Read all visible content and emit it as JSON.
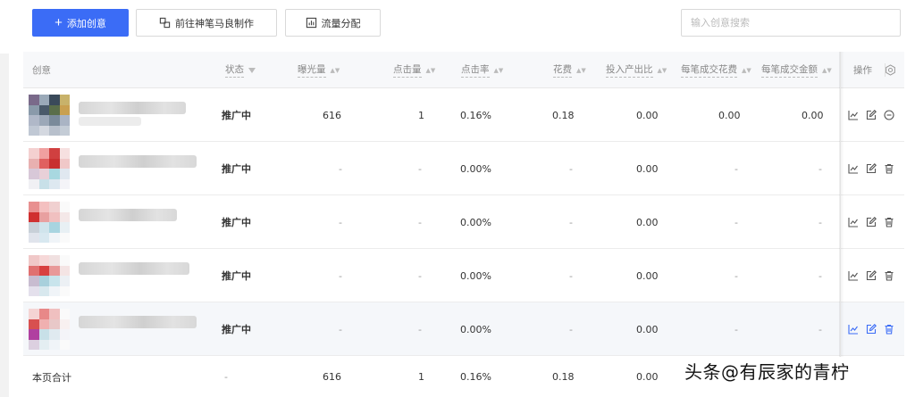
{
  "toolbar": {
    "add_label": "添加创意",
    "tool_label": "前往神笔马良制作",
    "flow_label": "流量分配",
    "search_placeholder": "输入创意搜索"
  },
  "columns": {
    "creative": "创意",
    "status": "状态",
    "impressions": "曝光量",
    "clicks": "点击量",
    "ctr": "点击率",
    "cost": "花费",
    "roi": "投入产出比",
    "cost_per_deal": "每笔成交花费",
    "amount_per_deal": "每笔成交金额",
    "actions": "操作"
  },
  "rows": [
    {
      "status": "推广中",
      "impressions": "616",
      "clicks": "1",
      "ctr": "0.16%",
      "cost": "0.18",
      "roi": "0.00",
      "cost_per_deal": "0.00",
      "amount_per_deal": "0.00",
      "third_icon": "minus-circle-icon"
    },
    {
      "status": "推广中",
      "impressions": "-",
      "clicks": "-",
      "ctr": "0.00%",
      "cost": "-",
      "roi": "0.00",
      "cost_per_deal": "-",
      "amount_per_deal": "-",
      "third_icon": "trash-icon"
    },
    {
      "status": "推广中",
      "impressions": "-",
      "clicks": "-",
      "ctr": "0.00%",
      "cost": "-",
      "roi": "0.00",
      "cost_per_deal": "-",
      "amount_per_deal": "-",
      "third_icon": "trash-icon"
    },
    {
      "status": "推广中",
      "impressions": "-",
      "clicks": "-",
      "ctr": "0.00%",
      "cost": "-",
      "roi": "0.00",
      "cost_per_deal": "-",
      "amount_per_deal": "-",
      "third_icon": "trash-icon"
    },
    {
      "status": "推广中",
      "impressions": "-",
      "clicks": "-",
      "ctr": "0.00%",
      "cost": "-",
      "roi": "0.00",
      "cost_per_deal": "-",
      "amount_per_deal": "-",
      "third_icon": "trash-icon"
    }
  ],
  "totals": {
    "label": "本页合计",
    "status": "-",
    "impressions": "616",
    "clicks": "1",
    "ctr": "0.16%",
    "cost": "0.18",
    "roi": "0.00"
  },
  "watermark": "头条@有辰家的青柠",
  "colors": {
    "primary": "#3b6cf6",
    "header_bg": "#f7f8fa",
    "hover_row": "#f5f7fa"
  }
}
